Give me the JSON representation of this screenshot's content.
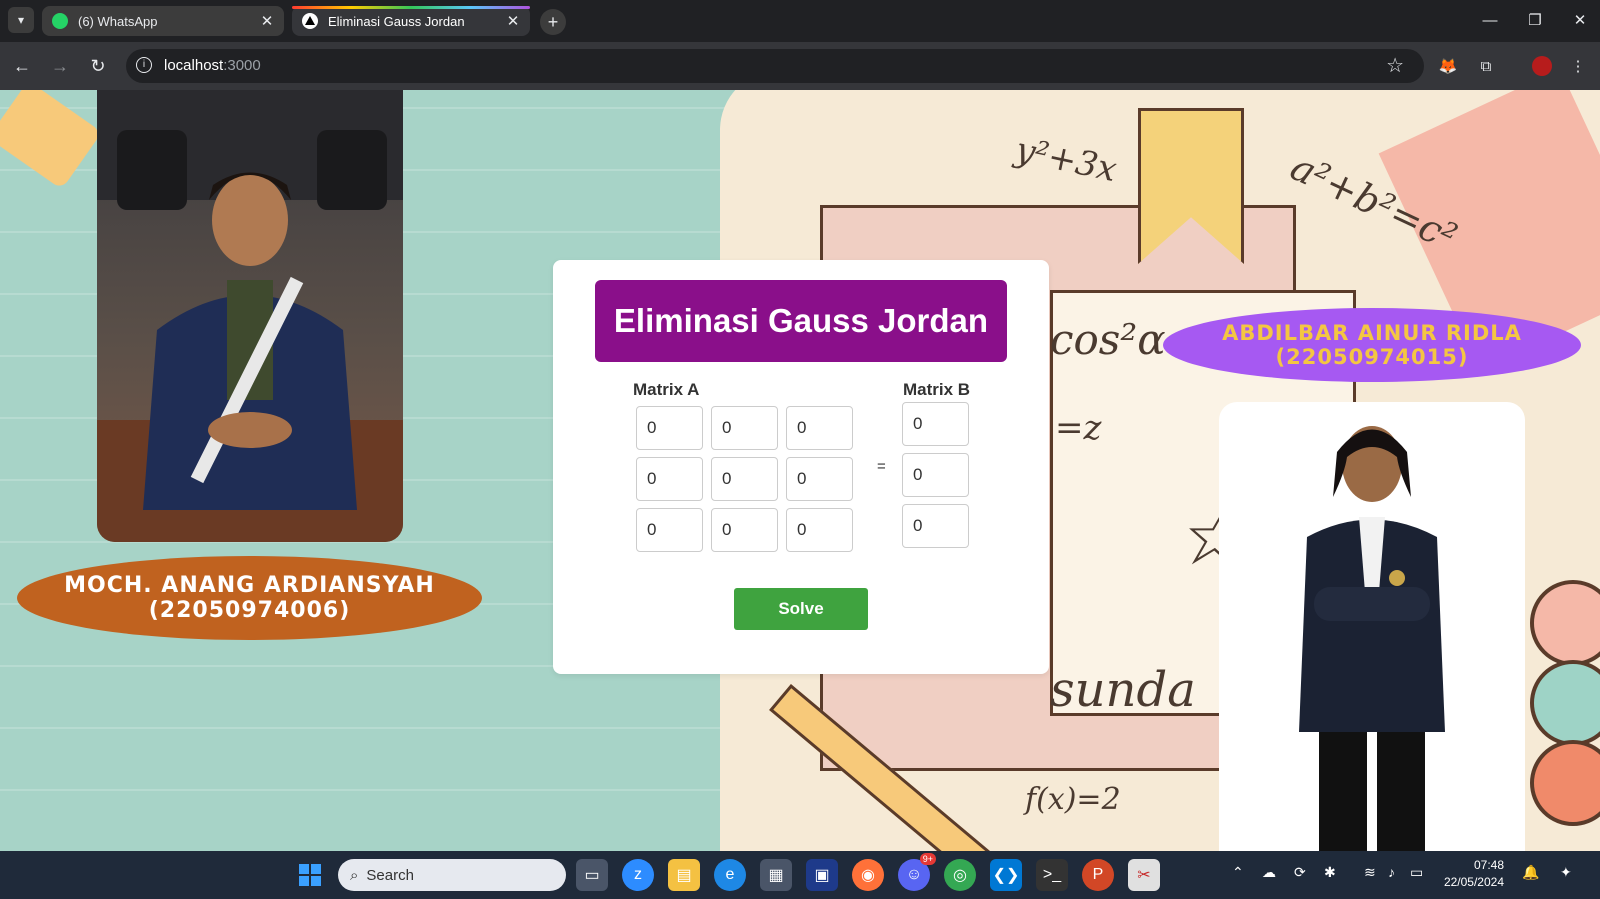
{
  "browser": {
    "tabs": [
      {
        "title": "(6) WhatsApp",
        "favicon": "whatsapp-icon",
        "active": false
      },
      {
        "title": "Eliminasi Gauss Jordan",
        "favicon": "triangle-icon",
        "active": true
      }
    ],
    "url_host": "localhost",
    "url_port": ":3000"
  },
  "app": {
    "title": "Eliminasi Gauss Jordan",
    "matrix_a_label": "Matrix A",
    "matrix_b_label": "Matrix B",
    "equals": "=",
    "matrix_a": [
      [
        "0",
        "0",
        "0"
      ],
      [
        "0",
        "0",
        "0"
      ],
      [
        "0",
        "0",
        "0"
      ]
    ],
    "matrix_b": [
      "0",
      "0",
      "0"
    ],
    "solve_label": "Solve"
  },
  "people": {
    "left_name": "MOCH. ANANG ARDIANSYAH",
    "left_id": "(22050974006)",
    "right_name": "ABDILBAR AINUR RIDLA",
    "right_id": "(22050974015)"
  },
  "background_text": {
    "eq1": "y²+3x",
    "eq2": "a²+b²=c²",
    "eq3": "cos²α",
    "eq4": "=z",
    "eq5": "sunda",
    "eq6": "f(x)=2"
  },
  "taskbar": {
    "search_placeholder": "Search",
    "time": "07:48",
    "date": "22/05/2024",
    "discord_badge": "9+"
  },
  "colors": {
    "title_bg": "#8a0f8a",
    "solve_bg": "#3fa33f",
    "left_pill": "#c0621f",
    "right_pill": "#a659f2",
    "right_pill_text": "#f4c642",
    "page_bg": "#a7d3c7"
  }
}
